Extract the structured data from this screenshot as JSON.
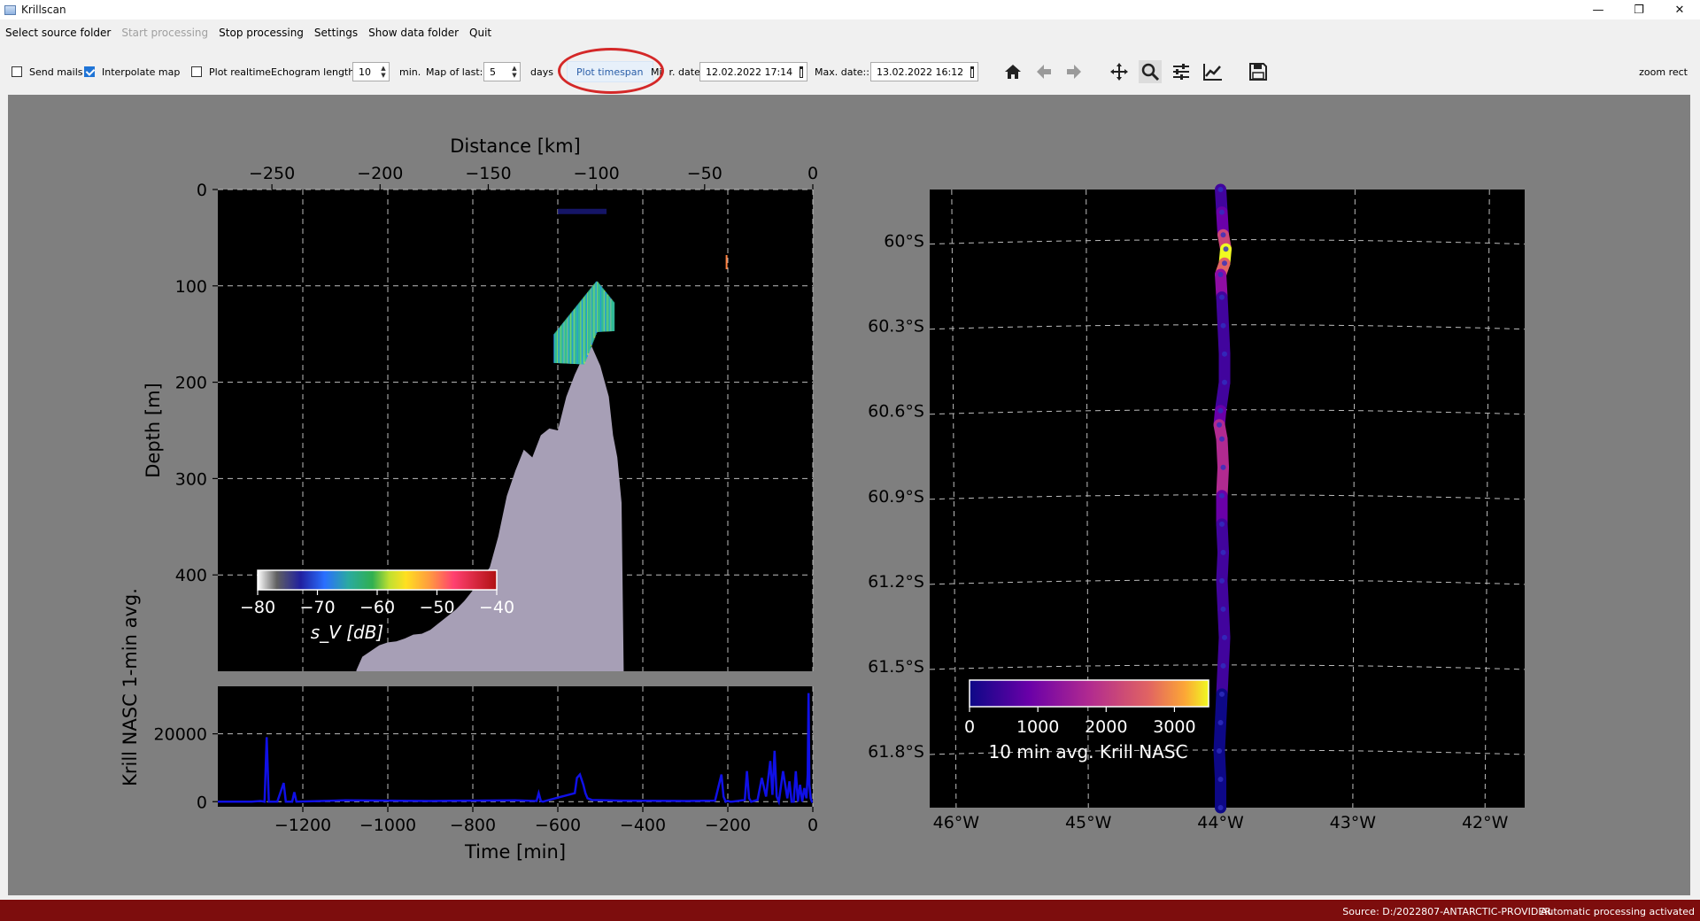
{
  "window": {
    "title": "Krillscan",
    "controls": [
      "—",
      "❐",
      "✕"
    ]
  },
  "menu": {
    "items": [
      {
        "label": "Select source folder",
        "enabled": true
      },
      {
        "label": "Start processing",
        "enabled": false
      },
      {
        "label": "Stop processing",
        "enabled": true
      },
      {
        "label": "Settings",
        "enabled": true
      },
      {
        "label": "Show data folder",
        "enabled": true
      },
      {
        "label": "Quit",
        "enabled": true
      }
    ]
  },
  "toolbar": {
    "send_mails": {
      "label": "Send mails",
      "checked": false
    },
    "interpolate_map": {
      "label": "Interpolate map",
      "checked": true
    },
    "plot_realtime": {
      "label": "Plot realtime",
      "checked": false
    },
    "echogram_length": {
      "label": "Echogram length:",
      "value": "10",
      "unit": "min."
    },
    "map_of_last": {
      "label": "Map of last:",
      "value": "5",
      "unit": "days"
    },
    "plot_timespan": "Plot timespan",
    "min_date": {
      "label_a": "Mi",
      "label_b": "r. date:",
      "value": "12.02.2022 17:14"
    },
    "max_date": {
      "label": "Max. date::",
      "value": "13.02.2022 16:12"
    },
    "mode": "zoom rect",
    "nav_icons": [
      "home-icon",
      "back-arrow-icon",
      "forward-arrow-icon",
      "pan-icon",
      "zoom-icon",
      "configure-subplots-icon",
      "edit-axis-icon",
      "save-icon"
    ]
  },
  "status": {
    "source": "Source: D:/2022807-ANTARCTIC-PROVIDER",
    "processing": "Automatic processing activated"
  },
  "colors": {
    "plot_bg": "#7f7f7f",
    "axes_bg": "#000000",
    "seabed": "#a79fb6",
    "nasc_line": "#1010e6",
    "status_bar": "#7d0d0d",
    "highlight": "#d42828"
  },
  "chart_data": [
    {
      "type": "heatmap",
      "name": "echogram",
      "xlabel_top": "Distance [km]",
      "top_ticks": [
        -250,
        -200,
        -150,
        -100,
        -50,
        0
      ],
      "top_xlim": [
        -275,
        0
      ],
      "ylabel": "Depth [m]",
      "y_ticks": [
        0,
        100,
        200,
        300,
        400
      ],
      "ylim": [
        500,
        0
      ],
      "xlim": [
        -1400,
        0
      ],
      "grid": true,
      "seabed": {
        "x": [
          -1074,
          -1060,
          -1040,
          -1020,
          -1000,
          -980,
          -960,
          -940,
          -920,
          -900,
          -880,
          -860,
          -840,
          -820,
          -800,
          -780,
          -760,
          -740,
          -720,
          -700,
          -680,
          -660,
          -640,
          -620,
          -600,
          -580,
          -560,
          -540,
          -520,
          -500,
          -480,
          -470,
          -460,
          -450,
          -445
        ],
        "depth": [
          499,
          485,
          479,
          473,
          470,
          469,
          466,
          462,
          461,
          457,
          450,
          443,
          436,
          427,
          416,
          405,
          392,
          360,
          318,
          292,
          270,
          278,
          255,
          248,
          250,
          215,
          192,
          173,
          163,
          183,
          215,
          255,
          278,
          325,
          499
        ]
      },
      "krill_schools": [
        {
          "x": [
            -610,
            -470
          ],
          "depth": [
            95,
            200
          ],
          "sv": -60
        }
      ],
      "colorbar": {
        "label": "s_V [dB]",
        "ticks": [
          -80,
          -70,
          -60,
          -50,
          -40
        ],
        "range": [
          -80,
          -40
        ],
        "location": "lower-left"
      }
    },
    {
      "type": "line",
      "name": "nasc-timeseries",
      "xlabel": "Time [min]",
      "ylabel": "Krill NASC 1-min avg.",
      "x_ticks": [
        -1200,
        -1000,
        -800,
        -600,
        -400,
        -200,
        0
      ],
      "y_ticks": [
        0,
        20000
      ],
      "xlim": [
        -1400,
        0
      ],
      "ylim": [
        -1500,
        34000
      ],
      "grid": true,
      "series": [
        {
          "x": [
            -1400,
            -1320,
            -1300,
            -1290,
            -1285,
            -1280,
            -1275,
            -1260,
            -1245,
            -1240,
            -1235,
            -1225,
            -1220,
            -1215,
            -1100,
            -1000,
            -900,
            -800,
            -700,
            -650,
            -645,
            -640,
            -635,
            -600,
            -560,
            -555,
            -548,
            -540,
            -535,
            -530,
            -520,
            -450,
            -300,
            -230,
            -215,
            -210,
            -205,
            -200,
            -195,
            -190,
            -160,
            -155,
            -150,
            -145,
            -130,
            -120,
            -110,
            -100,
            -95,
            -90,
            -85,
            -80,
            -70,
            -60,
            -55,
            -50,
            -45,
            -40,
            -35,
            -30,
            -25,
            -20,
            -15,
            -12,
            -10,
            -8,
            -5,
            -2,
            0
          ],
          "values": [
            0,
            0,
            200,
            0,
            19000,
            0,
            0,
            0,
            5500,
            0,
            0,
            0,
            2800,
            0,
            400,
            300,
            200,
            300,
            400,
            200,
            2500,
            200,
            0,
            1200,
            2500,
            7000,
            8000,
            5000,
            2500,
            1000,
            500,
            300,
            200,
            300,
            8000,
            1500,
            0,
            300,
            0,
            0,
            500,
            9000,
            1000,
            0,
            500,
            7000,
            1500,
            12000,
            2000,
            15000,
            1500,
            0,
            9000,
            1000,
            6000,
            0,
            0,
            9000,
            0,
            5000,
            0,
            4000,
            1000,
            8000,
            32000,
            5000,
            1000,
            0,
            0
          ]
        }
      ]
    },
    {
      "type": "scatter",
      "name": "krill-map",
      "xlabel": "",
      "ylabel": "",
      "x_ticks": [
        -46,
        -45,
        -44,
        -43,
        -42
      ],
      "x_tick_labels": [
        "46°W",
        "45°W",
        "44°W",
        "43°W",
        "42°W"
      ],
      "y_ticks": [
        -60.0,
        -60.3,
        -60.6,
        -60.9,
        -61.2,
        -61.5,
        -61.8
      ],
      "y_tick_labels": [
        "60°S",
        "60.3°S",
        "60.6°S",
        "60.9°S",
        "61.2°S",
        "61.5°S",
        "61.8°S"
      ],
      "xlim": [
        -46.2,
        -41.7
      ],
      "ylim": [
        -62.0,
        -59.82
      ],
      "grid": true,
      "track": {
        "lat": [
          -59.82,
          -59.9,
          -59.98,
          -60.03,
          -60.08,
          -60.12,
          -60.2,
          -60.3,
          -60.4,
          -60.5,
          -60.6,
          -60.65,
          -60.7,
          -60.8,
          -60.9,
          -61.0,
          -61.1,
          -61.2,
          -61.3,
          -61.4,
          -61.5,
          -61.6,
          -61.7,
          -61.8,
          -61.9,
          -62.0
        ],
        "lon": [
          -44.0,
          -43.99,
          -43.98,
          -43.96,
          -43.97,
          -44.0,
          -43.99,
          -43.98,
          -43.97,
          -43.97,
          -44.0,
          -44.01,
          -43.99,
          -43.98,
          -43.99,
          -43.99,
          -43.98,
          -43.99,
          -43.98,
          -43.97,
          -43.98,
          -43.99,
          -44.0,
          -44.01,
          -44.0,
          -44.0
        ],
        "nasc": [
          300,
          600,
          1600,
          3600,
          2200,
          900,
          400,
          400,
          300,
          300,
          700,
          1500,
          1400,
          1300,
          800,
          300,
          200,
          200,
          200,
          200,
          200,
          150,
          150,
          150,
          150,
          150
        ]
      },
      "colorbar": {
        "label": "10 min avg. Krill NASC",
        "ticks": [
          0,
          1000,
          2000,
          3000
        ],
        "range": [
          0,
          3500
        ],
        "location": "lower-left"
      }
    }
  ]
}
